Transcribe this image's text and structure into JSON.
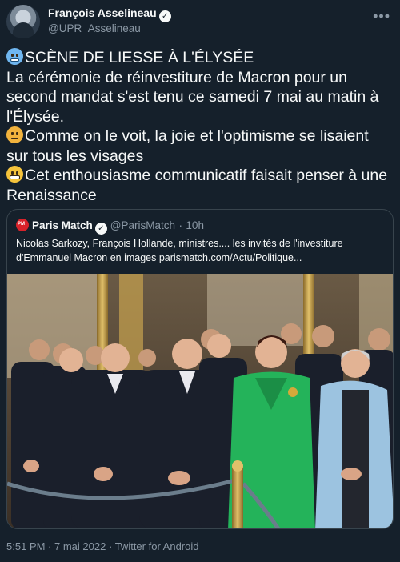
{
  "author": {
    "name": "François Asselineau",
    "handle": "@UPR_Asselineau",
    "verified": true,
    "avatar_icon": "avatar-photo"
  },
  "more_icon": "more-horizontal-icon",
  "tweet": {
    "lines": [
      {
        "emoji": "cold-face-emoji",
        "text": "SCÈNE DE LIESSE À L'ÉLYSÉE"
      },
      {
        "emoji": "",
        "text": "La cérémonie de réinvestiture de Macron pour un second mandat s'est tenu ce samedi 7 mai au matin à l'Élysée."
      },
      {
        "emoji": "angry-face-emoji",
        "text": "Comme on le voit, la joie et l'optimisme se lisaient sur tous les visages"
      },
      {
        "emoji": "grimacing-face-emoji",
        "text": "Cet enthousiasme communicatif faisait penser à une Renaissance"
      }
    ]
  },
  "quote": {
    "name": "Paris Match",
    "handle": "@ParisMatch",
    "separator": "·",
    "time": "10h",
    "verified": true,
    "logo_icon": "paris-match-logo",
    "text": "Nicolas Sarkozy, François Hollande, ministres.... les invités de l'investiture d'Emmanuel Macron en images parismatch.com/Actu/Politique..."
  },
  "footer": {
    "time": "5:51 PM",
    "separator": "·",
    "date": "7 mai 2022",
    "source": "Twitter for Android"
  },
  "colors": {
    "background": "#15202b",
    "text": "#f7f9f9",
    "muted": "#8b98a5",
    "border": "#38444d",
    "paris_match_red": "#d8222a"
  }
}
